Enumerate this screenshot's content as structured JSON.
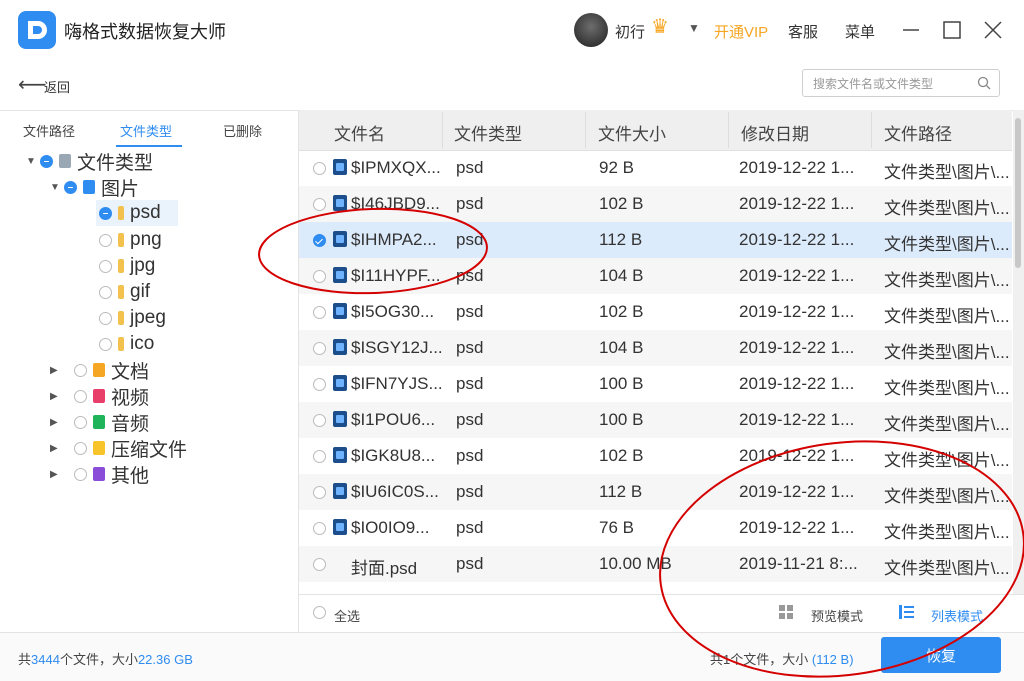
{
  "app": {
    "title": "嗨格式数据恢复大师"
  },
  "header": {
    "username": "初行",
    "vip_label": "开通VIP",
    "service_label": "客服",
    "menu_label": "菜单"
  },
  "toolbar": {
    "back_label": "返回",
    "search_placeholder": "搜索文件名或文件类型"
  },
  "left_tabs": [
    {
      "label": "文件路径",
      "active": false
    },
    {
      "label": "文件类型",
      "active": true
    },
    {
      "label": "已删除",
      "active": false
    }
  ],
  "tree": [
    {
      "label": "文件类型"
    },
    {
      "label": "图片"
    },
    {
      "label": "psd"
    },
    {
      "label": "png"
    },
    {
      "label": "jpg"
    },
    {
      "label": "gif"
    },
    {
      "label": "jpeg"
    },
    {
      "label": "ico"
    },
    {
      "label": "文档"
    },
    {
      "label": "视频"
    },
    {
      "label": "音频"
    },
    {
      "label": "压缩文件"
    },
    {
      "label": "其他"
    }
  ],
  "table": {
    "columns": [
      "文件名",
      "文件类型",
      "文件大小",
      "修改日期",
      "文件路径"
    ],
    "rows": [
      {
        "name": "$IPMXQX...",
        "type": "psd",
        "size": "92 B",
        "date": "2019-12-22 1...",
        "path": "文件类型\\图片\\..."
      },
      {
        "name": "$I46JBD9...",
        "type": "psd",
        "size": "102 B",
        "date": "2019-12-22 1...",
        "path": "文件类型\\图片\\..."
      },
      {
        "name": "$IHMPA2...",
        "type": "psd",
        "size": "112 B",
        "date": "2019-12-22 1...",
        "path": "文件类型\\图片\\..."
      },
      {
        "name": "$I11HYPF...",
        "type": "psd",
        "size": "104 B",
        "date": "2019-12-22 1...",
        "path": "文件类型\\图片\\..."
      },
      {
        "name": "$I5OG30...",
        "type": "psd",
        "size": "102 B",
        "date": "2019-12-22 1...",
        "path": "文件类型\\图片\\..."
      },
      {
        "name": "$ISGY12J...",
        "type": "psd",
        "size": "104 B",
        "date": "2019-12-22 1...",
        "path": "文件类型\\图片\\..."
      },
      {
        "name": "$IFN7YJS...",
        "type": "psd",
        "size": "100 B",
        "date": "2019-12-22 1...",
        "path": "文件类型\\图片\\..."
      },
      {
        "name": "$I1POU6...",
        "type": "psd",
        "size": "100 B",
        "date": "2019-12-22 1...",
        "path": "文件类型\\图片\\..."
      },
      {
        "name": "$IGK8U8...",
        "type": "psd",
        "size": "102 B",
        "date": "2019-12-22 1...",
        "path": "文件类型\\图片\\..."
      },
      {
        "name": "$IU6IC0S...",
        "type": "psd",
        "size": "112 B",
        "date": "2019-12-22 1...",
        "path": "文件类型\\图片\\..."
      },
      {
        "name": "$IO0IO9...",
        "type": "psd",
        "size": "76 B",
        "date": "2019-12-22 1...",
        "path": "文件类型\\图片\\..."
      },
      {
        "name": "封面.psd",
        "type": "psd",
        "size": "10.00 MB",
        "date": "2019-11-21 8:...",
        "path": "文件类型\\图片\\..."
      }
    ]
  },
  "footer": {
    "select_all": "全选",
    "preview_mode": "预览模式",
    "list_mode": "列表模式"
  },
  "status": {
    "total_prefix": "共",
    "total_count": "3444",
    "total_mid": "个文件，大小",
    "total_size": "22.36 GB",
    "selected_prefix": "共1个文件，大小",
    "selected_size": "(112 B)",
    "recover_label": "恢复"
  },
  "colors": {
    "accent": "#2f8cf0",
    "vip": "#f5a623",
    "annotation": "#d40000"
  }
}
